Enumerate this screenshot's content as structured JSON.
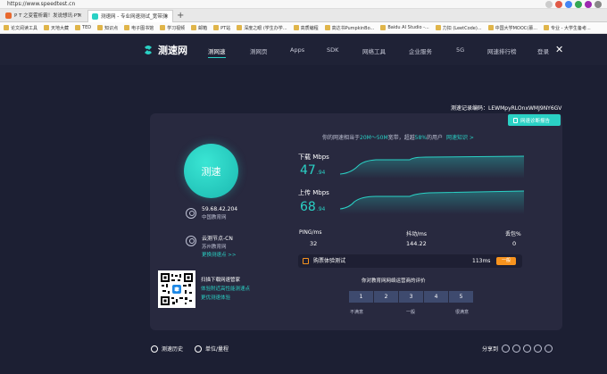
{
  "browser": {
    "url": "https://www.speedtest.cn",
    "tabs": [
      {
        "label": "P T 之变霍析霸！发说想讯·PT",
        "color": "#e8692e"
      },
      {
        "label": "测速网 - 专业网速测试_宽带测",
        "color": "#2ad1c5"
      }
    ],
    "bookmarks": [
      "论文阅读工具",
      "天地大藏",
      "TED",
      "知识点",
      "电子图书馆",
      "学习视频",
      "邮箱",
      "PT站",
      "深度之眼 (学生办学...",
      "高质编程",
      "高达书PumpkinBo...",
      "Baidu AI Studio -...",
      "力扣 (LeetCode)...",
      "中国大学MOOC(慕...",
      "专业 - 大学生备考..."
    ]
  },
  "nav": {
    "brand": "测速网",
    "items": [
      "测网速",
      "测网页",
      "Apps",
      "SDK",
      "网络工具",
      "企业服务",
      "5G",
      "网速排行榜",
      "登录"
    ]
  },
  "record": {
    "label": "测速记录编码：",
    "code": "LEWMpyRLOnxWMJ9NY6GV"
  },
  "report_button": "网速诊断报告",
  "test_button": "测速",
  "info": {
    "ip": "59.68.42.204",
    "isp": "中国教育网",
    "node": "云测节点-CN",
    "node_isp": "苏州教育网",
    "switch_node": "更换测速点 >>"
  },
  "qr": {
    "line1": "扫描下载网速管家",
    "line2": "体验附近高性能测速点",
    "line3": "更优测速体验"
  },
  "summary": {
    "prefix": "你的网速相当于",
    "band": "20M～50M",
    "mid": "宽带，超越",
    "percent": "58%",
    "suffix": "的用户",
    "link": "网速知识 >"
  },
  "download": {
    "label": "下载 Mbps",
    "value": "47",
    "decimal": ".94"
  },
  "upload": {
    "label": "上传 Mbps",
    "value": "68",
    "decimal": ".94"
  },
  "stats": [
    {
      "label": "PING/ms",
      "value": "32"
    },
    {
      "label": "抖动/ms",
      "value": "144.22"
    },
    {
      "label": "丢包%",
      "value": "0"
    }
  ],
  "game": {
    "label": "购票体验测试",
    "ms": "113ms",
    "badge": "一般"
  },
  "evaluation": {
    "question": "你对教育网网络运营商的评价",
    "options": [
      "1",
      "2",
      "3",
      "4",
      "5"
    ],
    "scale": [
      "不满意",
      "一般",
      "很满意"
    ]
  },
  "footer": {
    "history": "测速历史",
    "unit": "单位/量程",
    "share": "分享到"
  },
  "colors": {
    "accent": "#2ad1c5",
    "background": "#1c1f33",
    "card": "#28293f",
    "orange": "#f7931e"
  }
}
